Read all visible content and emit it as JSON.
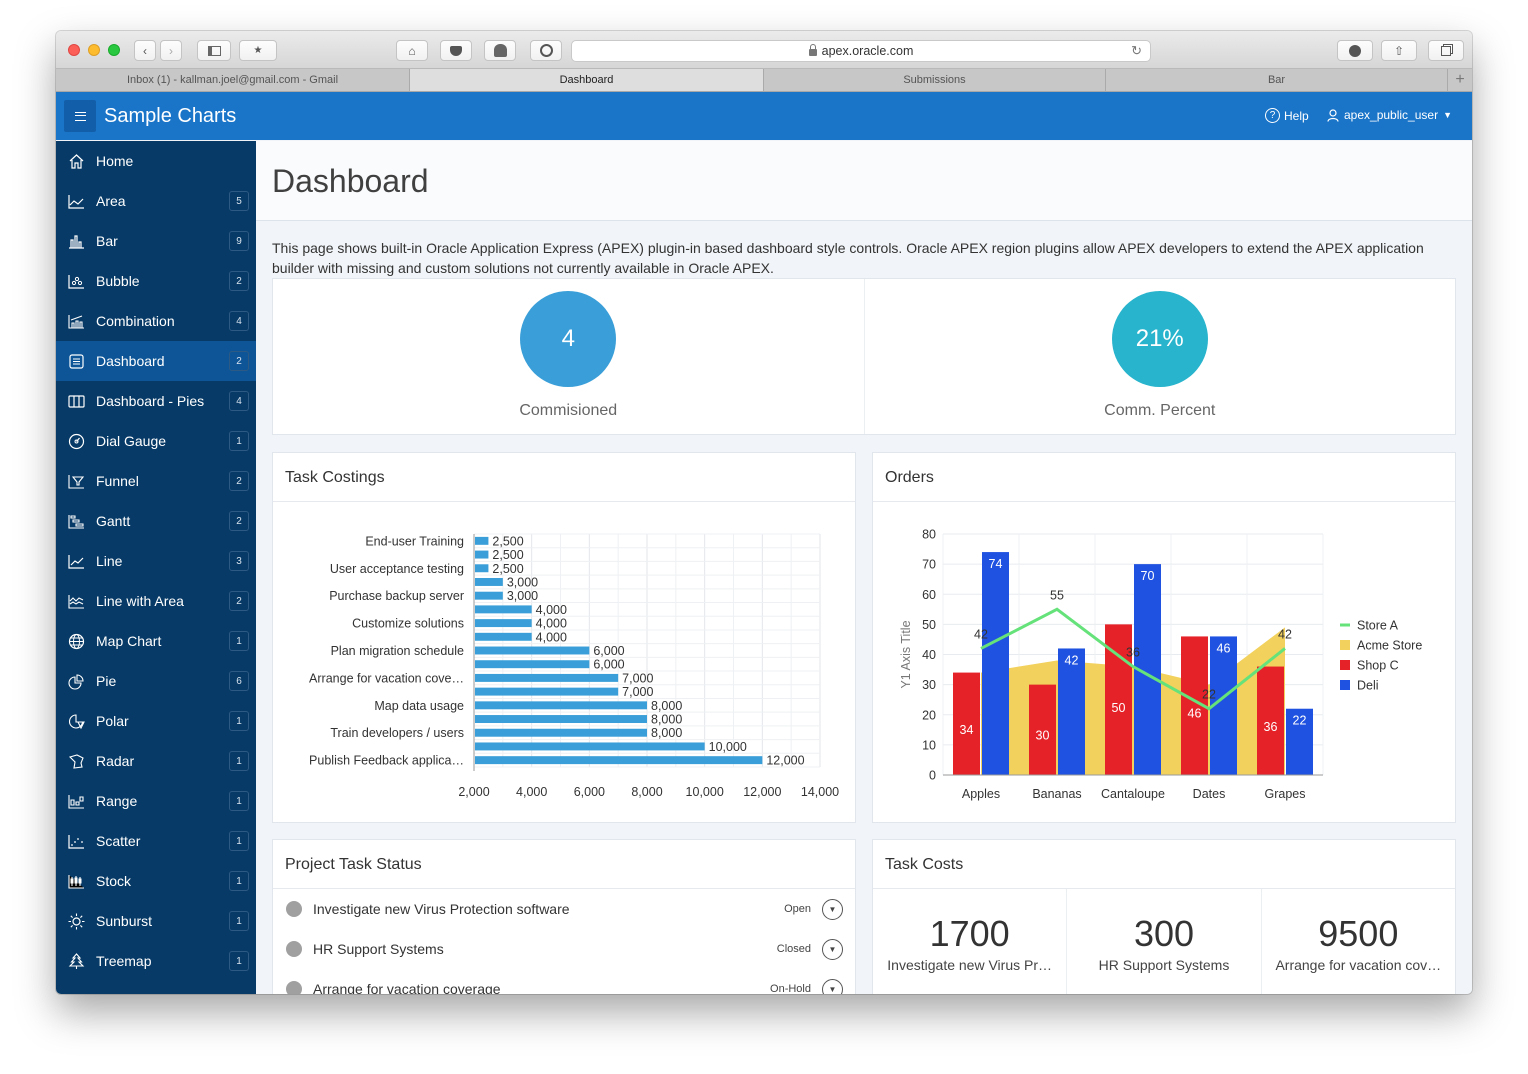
{
  "browser": {
    "url": "apex.oracle.com",
    "tabs": [
      {
        "label": "Inbox (1) - kallman.joel@gmail.com - Gmail",
        "active": false
      },
      {
        "label": "Dashboard",
        "active": true
      },
      {
        "label": "Submissions",
        "active": false
      },
      {
        "label": "Bar",
        "active": false
      }
    ],
    "new_tab_label": "+"
  },
  "app": {
    "title": "Sample Charts",
    "help_label": "Help",
    "user_label": "apex_public_user"
  },
  "sidebar": {
    "items": [
      {
        "label": "Home",
        "icon": "home-icon",
        "badge": null
      },
      {
        "label": "Area",
        "icon": "area-chart-icon",
        "badge": "5"
      },
      {
        "label": "Bar",
        "icon": "bar-chart-icon",
        "badge": "9"
      },
      {
        "label": "Bubble",
        "icon": "bubble-chart-icon",
        "badge": "2"
      },
      {
        "label": "Combination",
        "icon": "combination-chart-icon",
        "badge": "4"
      },
      {
        "label": "Dashboard",
        "icon": "dashboard-icon",
        "badge": "2",
        "active": true
      },
      {
        "label": "Dashboard - Pies",
        "icon": "columns-icon",
        "badge": "4"
      },
      {
        "label": "Dial Gauge",
        "icon": "gauge-icon",
        "badge": "1"
      },
      {
        "label": "Funnel",
        "icon": "funnel-icon",
        "badge": "2"
      },
      {
        "label": "Gantt",
        "icon": "gantt-icon",
        "badge": "2"
      },
      {
        "label": "Line",
        "icon": "line-chart-icon",
        "badge": "3"
      },
      {
        "label": "Line with Area",
        "icon": "line-area-chart-icon",
        "badge": "2"
      },
      {
        "label": "Map Chart",
        "icon": "globe-icon",
        "badge": "1"
      },
      {
        "label": "Pie",
        "icon": "pie-chart-icon",
        "badge": "6"
      },
      {
        "label": "Polar",
        "icon": "polar-chart-icon",
        "badge": "1"
      },
      {
        "label": "Radar",
        "icon": "radar-chart-icon",
        "badge": "1"
      },
      {
        "label": "Range",
        "icon": "range-chart-icon",
        "badge": "1"
      },
      {
        "label": "Scatter",
        "icon": "scatter-chart-icon",
        "badge": "1"
      },
      {
        "label": "Stock",
        "icon": "stock-chart-icon",
        "badge": "1"
      },
      {
        "label": "Sunburst",
        "icon": "sunburst-icon",
        "badge": "1"
      },
      {
        "label": "Treemap",
        "icon": "treemap-icon",
        "badge": "1"
      }
    ]
  },
  "page": {
    "title": "Dashboard",
    "description": "This page shows built-in Oracle Application Express (APEX) plugin-in based dashboard style controls. Oracle APEX region plugins allow APEX developers to extend the APEX application builder with missing and custom solutions not currently available in Oracle APEX."
  },
  "badges": [
    {
      "value": "4",
      "label": "Commisioned",
      "color": "#3a9fd8"
    },
    {
      "value": "21%",
      "label": "Comm. Percent",
      "color": "#27b4cc"
    }
  ],
  "task_costings": {
    "title": "Task Costings"
  },
  "orders": {
    "title": "Orders"
  },
  "project_task_status": {
    "title": "Project Task Status",
    "items": [
      {
        "name": "Investigate new Virus Protection software",
        "status": "Open"
      },
      {
        "name": "HR Support Systems",
        "status": "Closed"
      },
      {
        "name": "Arrange for vacation coverage",
        "status": "On-Hold"
      }
    ]
  },
  "task_costs": {
    "title": "Task Costs",
    "items": [
      {
        "value": "1700",
        "label": "Investigate new Virus Pr…"
      },
      {
        "value": "300",
        "label": "HR Support Systems"
      },
      {
        "value": "9500",
        "label": "Arrange for vacation cov…"
      }
    ]
  },
  "chart_data": [
    {
      "type": "bar",
      "orientation": "horizontal",
      "title": "Task Costings",
      "categories": [
        "End-user Training",
        "",
        "User acceptance testing",
        "",
        "Purchase backup server",
        "",
        "Customize solutions",
        "",
        "Plan migration schedule",
        "",
        "Arrange for vacation cove…",
        "",
        "Map data usage",
        "",
        "Train developers / users",
        "",
        "Publish Feedback applica…"
      ],
      "values": [
        2500,
        2500,
        2500,
        3000,
        3000,
        4000,
        4000,
        4000,
        6000,
        6000,
        7000,
        7000,
        8000,
        8000,
        8000,
        10000,
        12000
      ],
      "value_labels": [
        "2,500",
        "2,500",
        "2,500",
        "3,000",
        "3,000",
        "4,000",
        "4,000",
        "4,000",
        "6,000",
        "6,000",
        "7,000",
        "7,000",
        "8,000",
        "8,000",
        "8,000",
        "10,000",
        "12,000"
      ],
      "xlim": [
        2000,
        14000
      ],
      "xticks": [
        "2,000",
        "4,000",
        "6,000",
        "8,000",
        "10,000",
        "12,000",
        "14,000"
      ],
      "xlabel": "",
      "ylabel": "",
      "color": "#3a9fd8",
      "grid": true
    },
    {
      "type": "combination",
      "title": "Orders",
      "categories": [
        "Apples",
        "Bananas",
        "Cantaloupe",
        "Dates",
        "Grapes"
      ],
      "ylabel": "Y1 Axis Title",
      "ylim": [
        0,
        80
      ],
      "yticks": [
        0,
        10,
        20,
        30,
        40,
        50,
        60,
        70,
        80
      ],
      "grid": true,
      "legend": "right",
      "series": [
        {
          "name": "Store A",
          "type": "line",
          "color": "#66e27a",
          "values": [
            42,
            55,
            36,
            22,
            42
          ]
        },
        {
          "name": "Acme Store",
          "type": "area",
          "color": "#f2d15c",
          "values": [
            34,
            38,
            36,
            30,
            49
          ]
        },
        {
          "name": "Shop C",
          "type": "bar",
          "color": "#e62229",
          "values": [
            34,
            30,
            50,
            46,
            36
          ]
        },
        {
          "name": "Deli",
          "type": "bar",
          "color": "#1f52e0",
          "values": [
            74,
            42,
            70,
            46,
            22
          ]
        }
      ]
    }
  ]
}
